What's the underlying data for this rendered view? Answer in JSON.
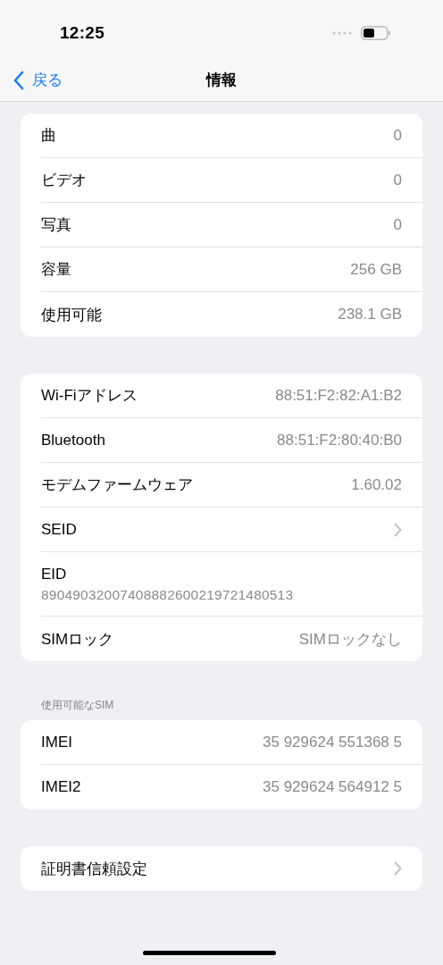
{
  "status_bar": {
    "time": "12:25"
  },
  "nav_bar": {
    "back": "戻る",
    "title": "情報"
  },
  "groups": [
    {
      "rows": [
        {
          "kind": "value",
          "label": "曲",
          "value": "0"
        },
        {
          "kind": "value",
          "label": "ビデオ",
          "value": "0"
        },
        {
          "kind": "value",
          "label": "写真",
          "value": "0"
        },
        {
          "kind": "value",
          "label": "容量",
          "value": "256 GB"
        },
        {
          "kind": "value",
          "label": "使用可能",
          "value": "238.1 GB"
        }
      ]
    },
    {
      "rows": [
        {
          "kind": "value",
          "label": "Wi-Fiアドレス",
          "value": "88:51:F2:82:A1:B2"
        },
        {
          "kind": "value",
          "label": "Bluetooth",
          "value": "88:51:F2:80:40:B0"
        },
        {
          "kind": "value",
          "label": "モデムファームウェア",
          "value": "1.60.02"
        },
        {
          "kind": "link",
          "label": "SEID"
        },
        {
          "kind": "stacked",
          "label": "EID",
          "value": "89049032007408882600219721480513"
        },
        {
          "kind": "value",
          "label": "SIMロック",
          "value": "SIMロックなし"
        }
      ]
    },
    {
      "header": "使用可能なSIM",
      "rows": [
        {
          "kind": "value",
          "label": "IMEI",
          "value": "35 929624 551368 5"
        },
        {
          "kind": "value",
          "label": "IMEI2",
          "value": "35 929624 564912 5"
        }
      ]
    },
    {
      "rows": [
        {
          "kind": "link",
          "label": "証明書信頼設定"
        }
      ]
    }
  ]
}
